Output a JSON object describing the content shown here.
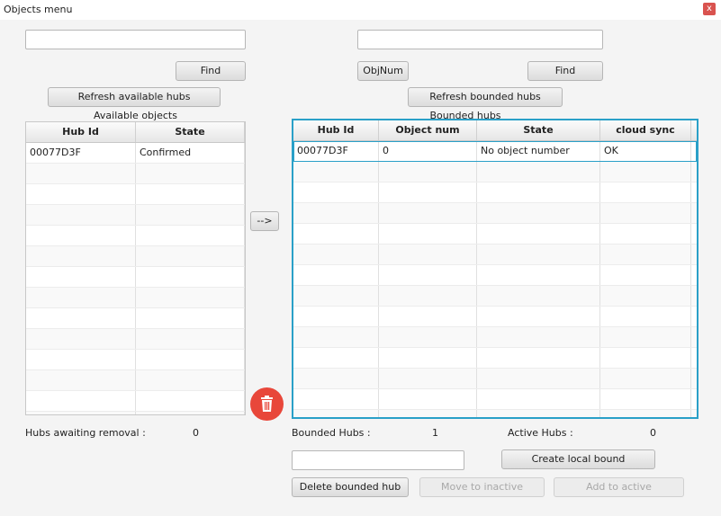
{
  "window": {
    "title": "Objects menu",
    "close": "x"
  },
  "left": {
    "search_value": "",
    "find_label": "Find",
    "refresh_label": "Refresh available hubs",
    "table_title": "Available objects",
    "columns": [
      "Hub Id",
      "State"
    ],
    "rows": [
      [
        "00077D3F",
        "Confirmed"
      ]
    ],
    "awaiting_label": "Hubs awaiting removal :",
    "awaiting_value": "0"
  },
  "transfer_label": "-->",
  "right": {
    "search_value": "",
    "objnum_label": "ObjNum",
    "find_label": "Find",
    "refresh_label": "Refresh bounded hubs",
    "table_title": "Bounded hubs",
    "columns": [
      "Hub Id",
      "Object num",
      "State",
      "cloud sync"
    ],
    "rows": [
      [
        "00077D3F",
        "0",
        "No object number",
        "OK"
      ]
    ],
    "bounded_label": "Bounded Hubs :",
    "bounded_value": "1",
    "active_label": "Active Hubs :",
    "active_value": "0",
    "local_bound_value": "",
    "create_local_label": "Create local bound",
    "delete_label": "Delete bounded hub",
    "move_inactive_label": "Move to inactive",
    "add_active_label": "Add to active"
  },
  "icons": {
    "delete": "trash-icon",
    "close": "close-icon"
  },
  "colors": {
    "focus": "#2aa0c8",
    "delete_button": "#e8473a"
  }
}
